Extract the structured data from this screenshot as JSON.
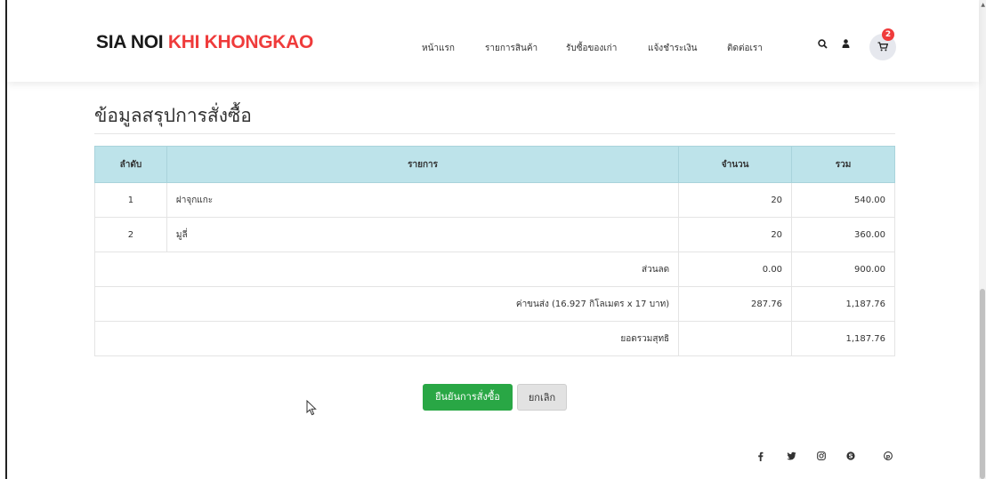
{
  "brand": {
    "part1": "SIA NOI ",
    "part2": "KHI KHONGKAO",
    "color_accent": "#ef3b3b"
  },
  "nav": [
    "หน้าแรก",
    "รายการสินค้า",
    "รับซื้อของเก่า",
    "แจ้งชำระเงิน",
    "ติดต่อเรา"
  ],
  "header_icons": {
    "search": "search-icon",
    "user": "user-icon",
    "cart": "cart-icon"
  },
  "cart_count": "2",
  "page_title": "ข้อมูลสรุปการสั่งซื้อ",
  "table": {
    "headers": [
      "ลำดับ",
      "รายการ",
      "จำนวน",
      "รวม"
    ],
    "rows": [
      {
        "no": "1",
        "item": "ฝาจุกแกะ",
        "qty": "20",
        "total": "540.00"
      },
      {
        "no": "2",
        "item": "มูลี่",
        "qty": "20",
        "total": "360.00"
      }
    ],
    "discount": {
      "label": "ส่วนลด",
      "qty": "0.00",
      "total": "900.00"
    },
    "shipping": {
      "label": "ค่าขนส่ง (16.927 กิโลเมตร x 17 บาท)",
      "qty": "287.76",
      "total": "1,187.76"
    },
    "net": {
      "label": "ยอดรวมสุทธิ",
      "total": "1,187.76"
    }
  },
  "buttons": {
    "confirm": "ยืนยันการสั่งซื้อ",
    "cancel": "ยกเลิก"
  },
  "social": [
    "facebook-icon",
    "twitter-icon",
    "instagram-icon",
    "skype-icon",
    "pinterest-icon"
  ]
}
